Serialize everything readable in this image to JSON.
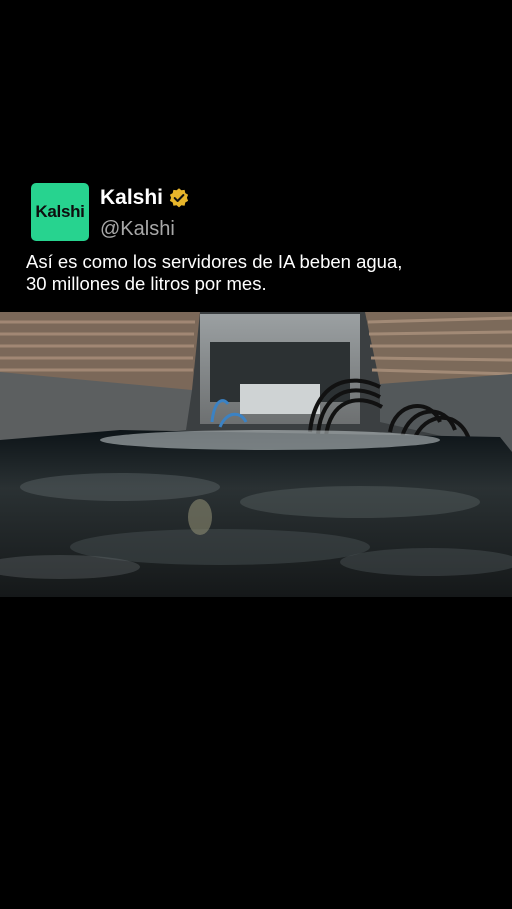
{
  "post": {
    "display_name": "Kalshi",
    "handle": "@Kalshi",
    "avatar_text": "Kalshi",
    "avatar_color": "#27d38f",
    "verified_icon": "verified-badge-icon",
    "verified_color": "#e7b52b",
    "text_line1": "Así es como los servidores de IA beben agua,",
    "text_line2": "30 millones de litros por mes."
  },
  "media": {
    "type": "video",
    "icon": "video-frame"
  }
}
